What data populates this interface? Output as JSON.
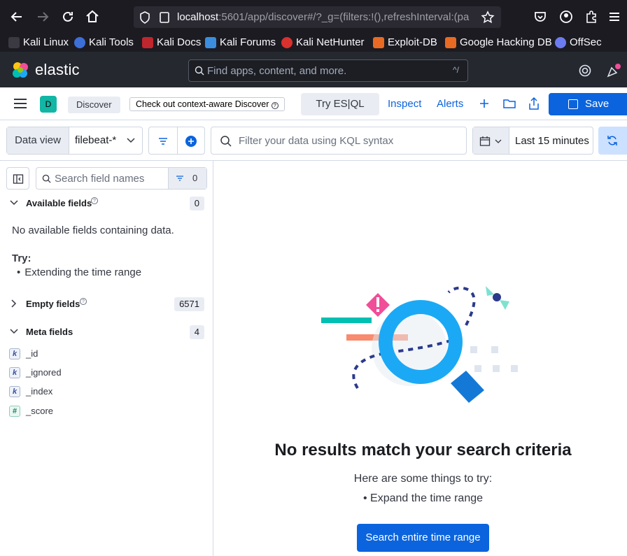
{
  "browser": {
    "url_host": "localhost",
    "url_rest": ":5601/app/discover#/?_g=(filters:!(),refreshInterval:(pa",
    "bookmarks": [
      "Kali Linux",
      "Kali Tools",
      "Kali Docs",
      "Kali Forums",
      "Kali NetHunter",
      "Exploit-DB",
      "Google Hacking DB",
      "OffSec"
    ]
  },
  "header": {
    "logo_text": "elastic",
    "search_placeholder": "Find apps, content, and more.",
    "search_shortcut": "^/"
  },
  "appbar": {
    "space_initial": "D",
    "breadcrumb": "Discover",
    "context_badge": "Check out context-aware Discover",
    "try_esql": "Try ES|QL",
    "inspect": "Inspect",
    "alerts": "Alerts",
    "save": "Save"
  },
  "querybar": {
    "data_view_label": "Data view",
    "data_view_value": "filebeat-*",
    "kql_placeholder": "Filter your data using KQL syntax",
    "time_range": "Last 15 minutes"
  },
  "sidebar": {
    "search_placeholder": "Search field names",
    "filter_count": "0",
    "available": {
      "title": "Available fields",
      "count": "0"
    },
    "no_fields_msg": "No available fields containing data.",
    "try_label": "Try:",
    "try_item": "Extending the time range",
    "empty": {
      "title": "Empty fields",
      "count": "6571"
    },
    "meta": {
      "title": "Meta fields",
      "count": "4"
    },
    "meta_fields": [
      {
        "type": "k",
        "name": "_id"
      },
      {
        "type": "k",
        "name": "_ignored"
      },
      {
        "type": "k",
        "name": "_index"
      },
      {
        "type": "#",
        "name": "_score"
      }
    ]
  },
  "main": {
    "title": "No results match your search criteria",
    "subtitle": "Here are some things to try:",
    "suggestion": "• Expand the time range",
    "button": "Search entire time range"
  },
  "colors": {
    "primary": "#0b64dd",
    "header_bg": "#25282f",
    "browser_bg": "#1c1b22"
  }
}
